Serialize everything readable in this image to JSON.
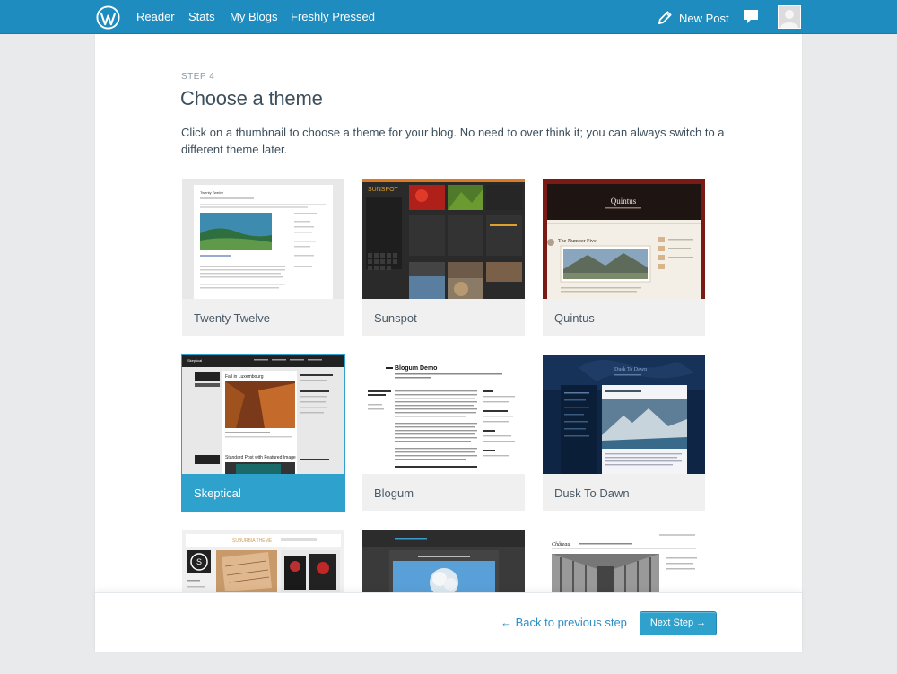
{
  "topbar": {
    "nav": [
      "Reader",
      "Stats",
      "My Blogs",
      "Freshly Pressed"
    ],
    "new_post": "New Post",
    "icons": {
      "logo": "wordpress-logo",
      "new_post": "pencil-icon",
      "notifications": "speech-bubble-icon",
      "avatar": "user-avatar"
    }
  },
  "page": {
    "step": "STEP 4",
    "title": "Choose a theme",
    "instructions": "Click on a thumbnail to choose a theme for your blog. No need to over think it; you can always switch to a different theme later."
  },
  "themes": [
    {
      "name": "Twenty Twelve",
      "selected": false
    },
    {
      "name": "Sunspot",
      "selected": false
    },
    {
      "name": "Quintus",
      "selected": false
    },
    {
      "name": "Skeptical",
      "selected": true
    },
    {
      "name": "Blogum",
      "selected": false
    },
    {
      "name": "Dusk To Dawn",
      "selected": false
    },
    {
      "name": "",
      "selected": false
    },
    {
      "name": "",
      "selected": false
    },
    {
      "name": "",
      "selected": false
    }
  ],
  "thumb_text": {
    "twenty_twelve": "Twenty Twelve",
    "sunspot": "SUNSPOT",
    "quintus": "Quintus",
    "quintus_post": "The Number Five",
    "skeptical": "Skeptical",
    "skeptical_post": "Fall in Luxembourg",
    "skeptical_post2": "Standard Post with Featured Image",
    "blogum": "Blogum Demo",
    "dusk": "Dusk To Dawn",
    "suburbia": "SUBURBIA THEME",
    "chateau": "Château"
  },
  "footer": {
    "back": "← Back to previous step",
    "next": "Next Step →"
  },
  "colors": {
    "topbar": "#1e8cbe",
    "accent": "#2ea2cc",
    "page_bg": "#e9eaeb"
  }
}
